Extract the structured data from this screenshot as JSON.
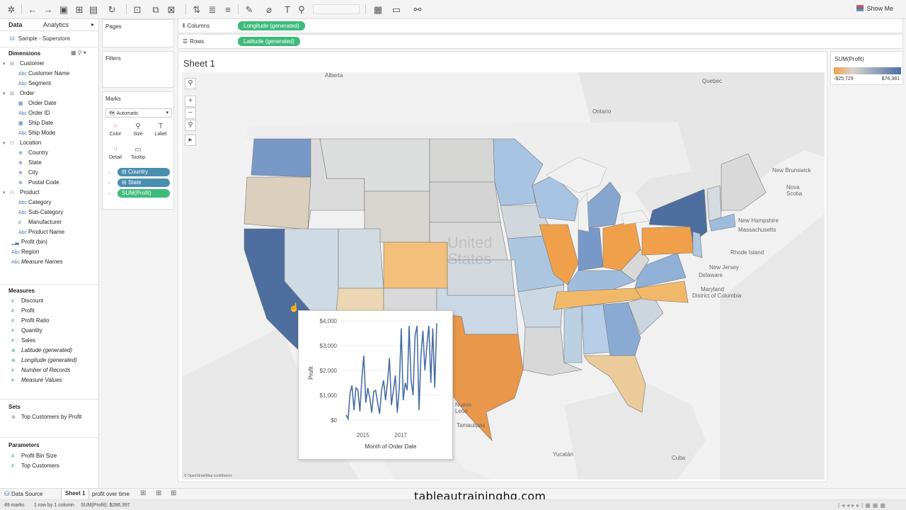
{
  "toolbar": {
    "show_me": "Show Me"
  },
  "data_pane": {
    "tab_data": "Data",
    "tab_analytics": "Analytics",
    "datasource": "Sample - Superstore",
    "dimensions_header": "Dimensions",
    "dimension_groups": [
      {
        "name": "Customer",
        "fields": [
          "Customer Name",
          "Segment"
        ]
      },
      {
        "name": "Order",
        "fields": [
          "Order Date",
          "Order ID",
          "Ship Date",
          "Ship Mode"
        ]
      },
      {
        "name": "Location",
        "fields": [
          "Country",
          "State",
          "City",
          "Postal Code"
        ]
      },
      {
        "name": "Product",
        "fields": [
          "Category",
          "Sub-Category",
          "Manufacturer",
          "Product Name"
        ]
      }
    ],
    "other_dimensions": [
      "Profit (bin)",
      "Region",
      "Measure Names"
    ],
    "measures_header": "Measures",
    "measures": [
      "Discount",
      "Profit",
      "Profit Ratio",
      "Quantity",
      "Sales",
      "Latitude (generated)",
      "Longitude (generated)",
      "Number of Records",
      "Measure Values"
    ],
    "sets_header": "Sets",
    "sets": [
      "Top Customers by Profit"
    ],
    "parameters_header": "Parameters",
    "parameters": [
      "Profit Bin Size",
      "Top Customers"
    ]
  },
  "cards": {
    "pages": "Pages",
    "filters": "Filters",
    "marks": "Marks",
    "mark_type": "Automatic",
    "buttons": [
      "Color",
      "Size",
      "Label",
      "Detail",
      "Tooltip"
    ],
    "pills": [
      "Country",
      "State",
      "SUM(Profit)"
    ]
  },
  "shelves": {
    "columns_label": "Columns",
    "columns_pill": "Longitude (generated)",
    "rows_label": "Rows",
    "rows_pill": "Latitude (generated)"
  },
  "view": {
    "sheet_title": "Sheet 1",
    "attribution": "© OpenStreetMap contributors",
    "map_labels": [
      "Alberta",
      "Quebec",
      "Ontario",
      "New Brunswick",
      "Nova Scotia",
      "New Hampshire",
      "Massachusetts",
      "Rhode Island",
      "New Jersey",
      "Delaware",
      "Maryland",
      "District of Columbia",
      "United States",
      "Nuevo León",
      "Tamaulipas",
      "Yucatán",
      "Cuba"
    ]
  },
  "legend": {
    "title": "SUM(Profit)",
    "min": "-$25,729",
    "max": "$76,381",
    "color_low": "#f0a04b",
    "color_high": "#4a6fa5"
  },
  "tooltip": {
    "chart_data": {
      "type": "line",
      "xlabel": "Month of Order Date",
      "ylabel": "Profit",
      "ylim": [
        -200,
        4000
      ],
      "yticks": [
        "$0",
        "$1,000",
        "$2,000",
        "$3,000",
        "$4,000"
      ],
      "xticks": [
        "2015",
        "2017"
      ],
      "series": [
        {
          "values": [
            200,
            50,
            1100,
            1400,
            400,
            1300,
            1200,
            350,
            1700,
            2600,
            700,
            1300,
            900,
            300,
            1150,
            1200,
            700,
            250,
            1200,
            1600,
            800,
            1500,
            2500,
            600,
            1200,
            1800,
            300,
            1300,
            3700,
            800,
            1500,
            1200,
            3800,
            1600,
            1000,
            3400,
            3800,
            400,
            2600,
            3600,
            2000,
            3000,
            3800,
            1500,
            3700,
            1300,
            3900
          ]
        }
      ]
    }
  },
  "bottom": {
    "data_source_tab": "Data Source",
    "sheet_tabs": [
      "Sheet 1",
      "profit over time"
    ],
    "status_marks": "49 marks",
    "status_rows": "1 row by 1 column",
    "status_sum": "SUM(Profit): $286,397",
    "watermark": "tableautraininghq.com"
  }
}
